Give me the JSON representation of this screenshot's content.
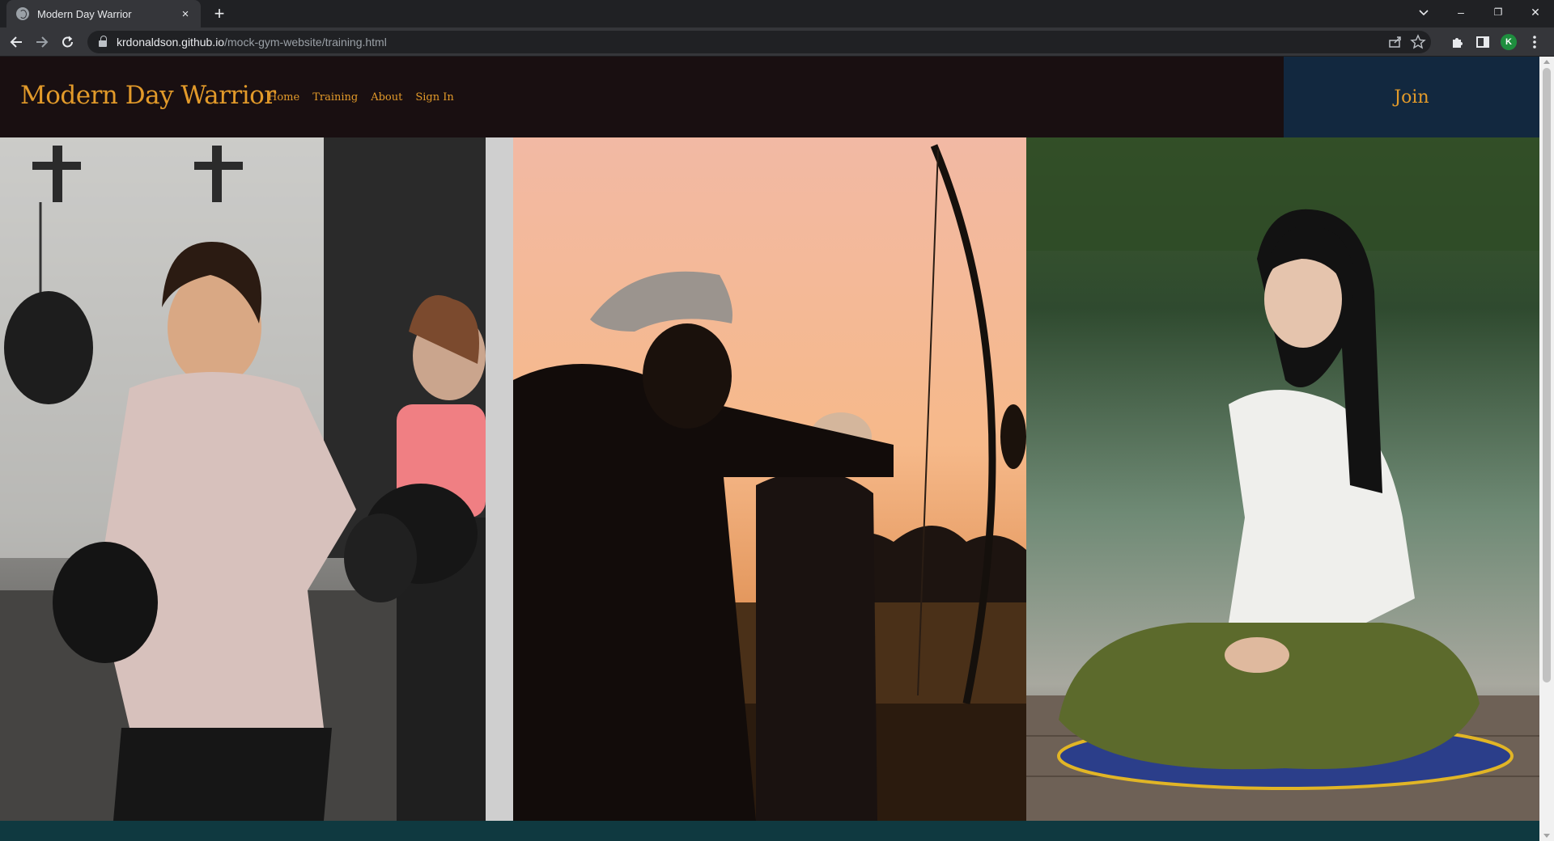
{
  "browser": {
    "tab": {
      "title": "Modern Day Warrior",
      "favicon": "globe-icon"
    },
    "new_tab_label": "+",
    "close_tab_label": "×",
    "address": {
      "host": "krdonaldson.github.io",
      "path": "/mock-gym-website/training.html"
    },
    "profile_initial": "K",
    "window_controls": {
      "minimize": "–",
      "restore": "❐",
      "close": "✕"
    }
  },
  "site": {
    "brand": "Modern Day Warrior",
    "nav": [
      "Home",
      "Training",
      "About",
      "Sign In"
    ],
    "join_label": "Join",
    "colors": {
      "accent": "#e29a2a",
      "header_bg": "#190f11",
      "join_bg": "#12283f",
      "footer_band": "#0f3940"
    }
  },
  "gallery": {
    "panels": [
      "boxing-photo",
      "archery-photo",
      "meditation-photo"
    ]
  }
}
